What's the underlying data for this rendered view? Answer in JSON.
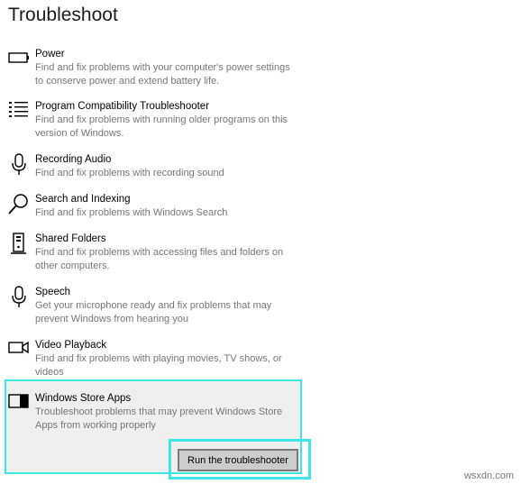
{
  "page": {
    "title": "Troubleshoot"
  },
  "items": [
    {
      "icon": "battery-icon",
      "title": "Power",
      "desc_lines": [
        "Find and fix problems with your computer's power settings",
        "to conserve power and extend battery life."
      ]
    },
    {
      "icon": "list-icon",
      "title": "Program Compatibility Troubleshooter",
      "desc_lines": [
        "Find and fix problems with running older programs on this",
        "version of Windows."
      ]
    },
    {
      "icon": "microphone-icon",
      "title": "Recording Audio",
      "desc_lines": [
        "Find and fix problems with recording sound"
      ]
    },
    {
      "icon": "search-icon",
      "title": "Search and Indexing",
      "desc_lines": [
        "Find and fix problems with Windows Search"
      ]
    },
    {
      "icon": "shared-folders-icon",
      "title": "Shared Folders",
      "desc_lines": [
        "Find and fix problems with accessing files and folders on",
        "other computers."
      ]
    },
    {
      "icon": "microphone-icon",
      "title": "Speech",
      "desc_lines": [
        "Get your microphone ready and fix problems that may",
        "prevent Windows from hearing you"
      ]
    },
    {
      "icon": "video-camera-icon",
      "title": "Video Playback",
      "desc_lines": [
        "Find and fix problems with playing movies, TV shows, or",
        "videos"
      ]
    },
    {
      "icon": "store-apps-icon",
      "title": "Windows Store Apps",
      "desc_lines": [
        "Troubleshoot problems that may prevent Windows Store",
        "Apps from working properly"
      ]
    }
  ],
  "run_button": {
    "label": "Run the troubleshooter"
  },
  "watermark": "wsxdn.com",
  "colors": {
    "highlight": "#3ee6e6",
    "selected_bg": "#efefef",
    "desc_text": "#767676",
    "button_bg": "#cccccc"
  }
}
